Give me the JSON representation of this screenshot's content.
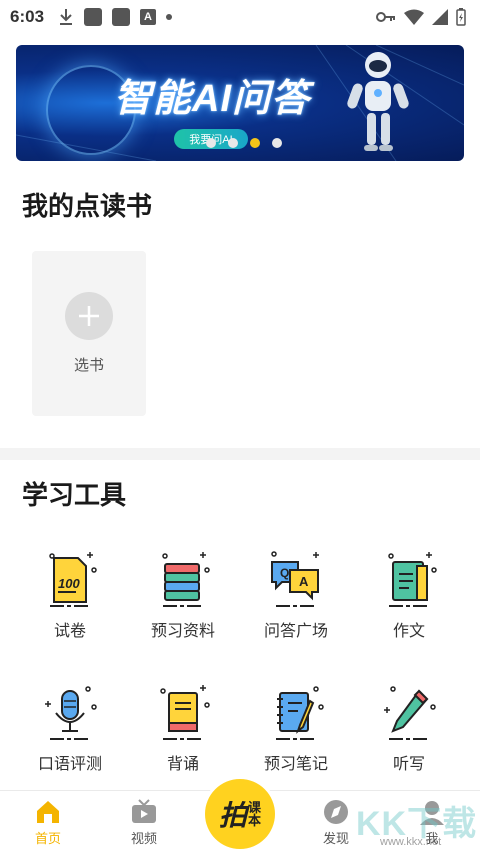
{
  "status_bar": {
    "time": "6:03",
    "a_icon_letter": "A"
  },
  "banner": {
    "title": "智能AI问答",
    "button_label": "我要问AI"
  },
  "reading_section": {
    "title": "我的点读书",
    "select_book_label": "选书"
  },
  "tools_section": {
    "title": "学习工具",
    "items": [
      {
        "label": "试卷",
        "icon": "exam-paper-icon"
      },
      {
        "label": "预习资料",
        "icon": "book-stack-icon"
      },
      {
        "label": "问答广场",
        "icon": "qa-bubbles-icon"
      },
      {
        "label": "作文",
        "icon": "notebook-icon"
      },
      {
        "label": "口语评测",
        "icon": "microphone-icon"
      },
      {
        "label": "背诵",
        "icon": "book-icon"
      },
      {
        "label": "预习笔记",
        "icon": "notepad-pen-icon"
      },
      {
        "label": "听写",
        "icon": "pencil-icon"
      }
    ]
  },
  "bottom_nav": {
    "home": "首页",
    "video": "视频",
    "center_main": "拍",
    "center_sub_1": "课",
    "center_sub_2": "本",
    "discover": "发现",
    "me": "我"
  },
  "colors": {
    "accent": "#ffd21f",
    "active_nav": "#f4b400"
  },
  "watermark": {
    "logo_text": "KK下载",
    "url": "www.kkx.net"
  }
}
